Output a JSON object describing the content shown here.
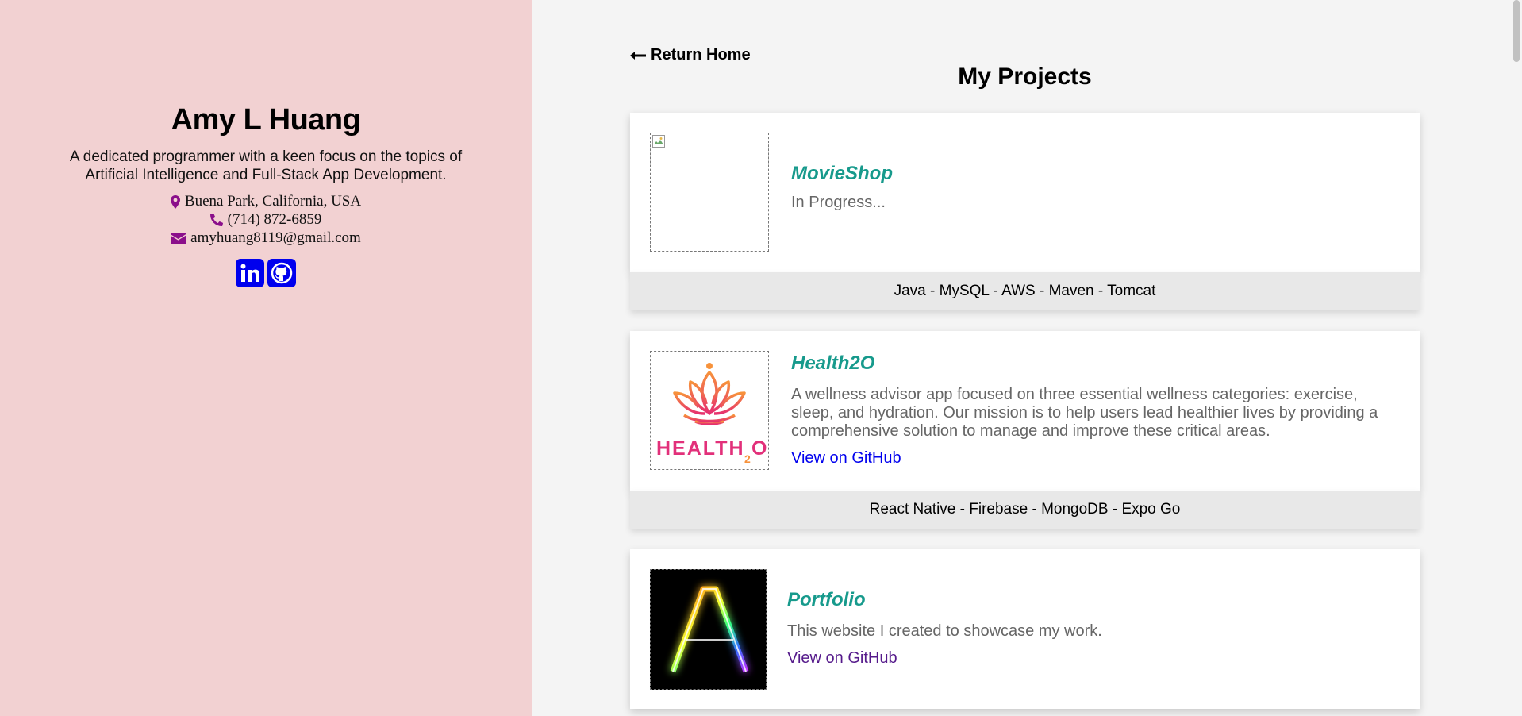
{
  "profile": {
    "name": "Amy L Huang",
    "bio": "A dedicated programmer with a keen focus on the topics of Artificial Intelligence and Full-Stack App Development.",
    "location": "Buena Park, California, USA",
    "phone": "(714) 872-6859",
    "email": "amyhuang8119@gmail.com",
    "socials": [
      {
        "icon": "linkedin-icon"
      },
      {
        "icon": "github-icon"
      }
    ]
  },
  "nav": {
    "return_label": "Return Home",
    "return_icon": "arrow-left-icon"
  },
  "page": {
    "title": "My Projects"
  },
  "projects": [
    {
      "title": "MovieShop",
      "description": "In Progress...",
      "link": "",
      "tech": "Java - MySQL - AWS - Maven - Tomcat",
      "thumbnail": "broken-image"
    },
    {
      "title": "Health2O",
      "description": "A wellness advisor app focused on three essential wellness categories: exercise, sleep, and hydration. Our mission is to help users lead healthier lives by providing a comprehensive solution to manage and improve these critical areas.",
      "link": "View on GitHub",
      "tech": "React Native - Firebase - MongoDB - Expo Go",
      "thumbnail": "health2o-logo",
      "logo_text": "HEALTH",
      "logo_sub": "2",
      "logo_end": "O"
    },
    {
      "title": "Portfolio",
      "description": "This website I created to showcase my work.",
      "link": "View on GitHub",
      "thumbnail": "neon-letter-A",
      "logo_letter": "A"
    }
  ],
  "colors": {
    "sidebar_bg": "#f2d1d2",
    "accent_title": "#179a8c",
    "link_unvisited": "#0000ee",
    "link_visited": "#551a8b",
    "contact_icon": "#8b0f8b",
    "social_bg": "#0000ee"
  }
}
